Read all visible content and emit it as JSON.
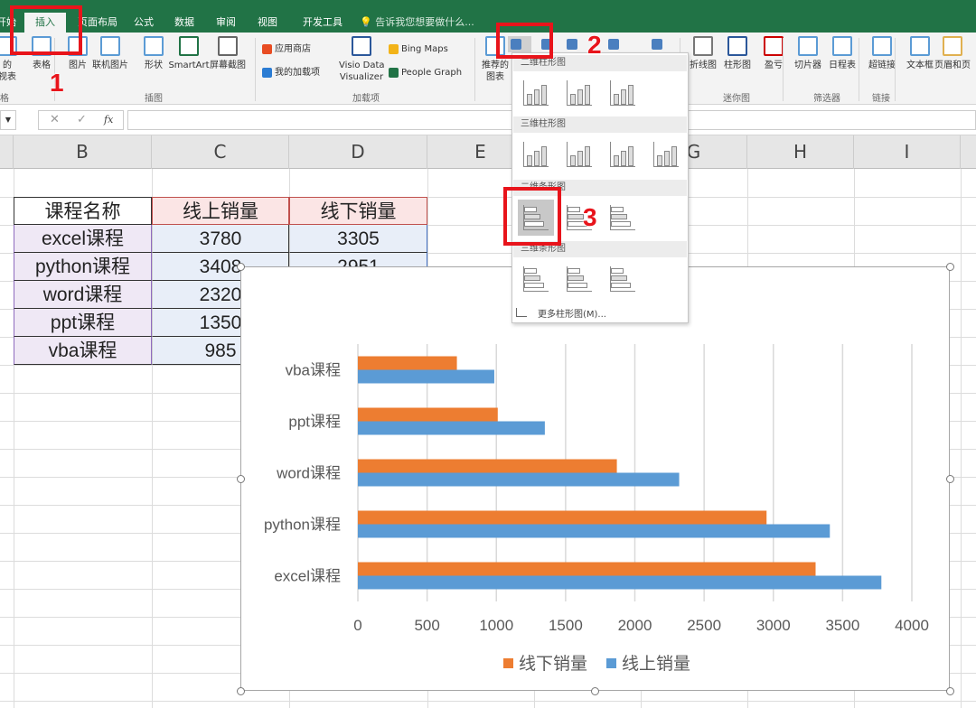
{
  "ribbon": {
    "tabs": [
      {
        "label": "开始"
      },
      {
        "label": "插入",
        "active": true
      },
      {
        "label": "页面布局"
      },
      {
        "label": "公式"
      },
      {
        "label": "数据"
      },
      {
        "label": "审阅"
      },
      {
        "label": "视图"
      },
      {
        "label": "开发工具"
      }
    ],
    "tell_me": "告诉我您想要做什么...",
    "buttons": {
      "pivot": "的\n视表",
      "table": "表格",
      "picture": "图片",
      "online_picture": "联机图片",
      "shapes": "形状",
      "smartart": "SmartArt",
      "screenshot": "屏幕截图",
      "store": "应用商店",
      "my_addins": "我的加载项",
      "visio": "Visio Data\nVisualizer",
      "bing": "Bing Maps",
      "people": "People Graph",
      "recommended": "推荐的\n图表",
      "line_spark": "折线图",
      "column_spark": "柱形图",
      "winloss": "盈亏",
      "slicer": "切片器",
      "timeline": "日程表",
      "hyperlink": "超链接",
      "textbox": "文本框",
      "header": "页眉和页"
    },
    "groups": {
      "tables": "格",
      "illustrations": "插图",
      "addins": "加载项",
      "sparklines": "迷你图",
      "filters": "筛选器",
      "links": "链接"
    }
  },
  "formula_bar": {
    "cancel": "✕",
    "enter": "✓",
    "fx": "fx",
    "value": ""
  },
  "columns": [
    "A",
    "B",
    "C",
    "D",
    "E",
    "F",
    "G",
    "H",
    "I"
  ],
  "table": {
    "headers": [
      "课程名称",
      "线上销量",
      "线下销量"
    ],
    "rows": [
      [
        "excel课程",
        "3780",
        "3305"
      ],
      [
        "python课程",
        "3408",
        "2951"
      ],
      [
        "word课程",
        "2320",
        ""
      ],
      [
        "ppt课程",
        "1350",
        ""
      ],
      [
        "vba课程",
        "985",
        ""
      ]
    ]
  },
  "dropdown": {
    "sections": [
      "二维柱形图",
      "三维柱形图",
      "二维条形图",
      "三维条形图"
    ],
    "more": "更多柱形图(M)..."
  },
  "annotations": [
    "1",
    "2",
    "3"
  ],
  "colors": {
    "excel_green": "#217346",
    "series_online": "#5b9bd5",
    "series_offline": "#ed7d31",
    "highlight": "#e8141b"
  },
  "chart_data": {
    "type": "bar",
    "orientation": "horizontal",
    "categories": [
      "excel课程",
      "python课程",
      "word课程",
      "ppt课程",
      "vba课程"
    ],
    "series": [
      {
        "name": "线上销量",
        "color": "#5b9bd5",
        "values": [
          3780,
          3408,
          2320,
          1350,
          985
        ]
      },
      {
        "name": "线下销量",
        "color": "#ed7d31",
        "values": [
          3305,
          2951,
          1870,
          1010,
          715
        ]
      }
    ],
    "xlim": [
      0,
      4000
    ],
    "xticks": [
      "0",
      "500",
      "1000",
      "1500",
      "2000",
      "2500",
      "3000",
      "3500",
      "4000"
    ],
    "grid": true,
    "legend": "bottom",
    "legend_entries": [
      "线下销量",
      "线上销量"
    ]
  }
}
